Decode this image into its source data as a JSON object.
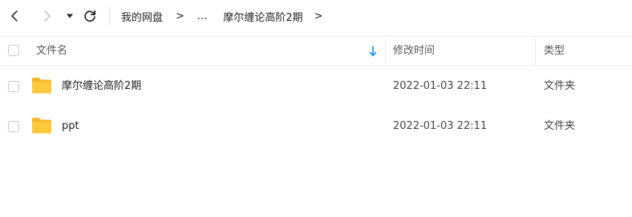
{
  "toolbar": {
    "back_icon": "chevron-left-icon",
    "forward_icon": "chevron-right-icon",
    "dropdown_icon": "caret-down-icon",
    "refresh_icon": "refresh-icon"
  },
  "breadcrumb": {
    "root": "我的网盘",
    "sep1": ">",
    "ellipsis": "...",
    "current": "摩尔缠论高阶2期",
    "sep2": ">"
  },
  "table": {
    "headers": {
      "name": "文件名",
      "mtime": "修改时间",
      "type": "类型"
    },
    "sort_icon": "sort-down-arrow-icon",
    "sort_color": "#1a8cff",
    "rows": [
      {
        "name": "摩尔缠论高阶2期",
        "mtime": "2022-01-03 22:11",
        "type": "文件夹",
        "icon": "folder-icon"
      },
      {
        "name": "ppt",
        "mtime": "2022-01-03 22:11",
        "type": "文件夹",
        "icon": "folder-icon"
      }
    ]
  },
  "colors": {
    "folder": "#ffc83d",
    "folder_back": "#f5b82a"
  }
}
